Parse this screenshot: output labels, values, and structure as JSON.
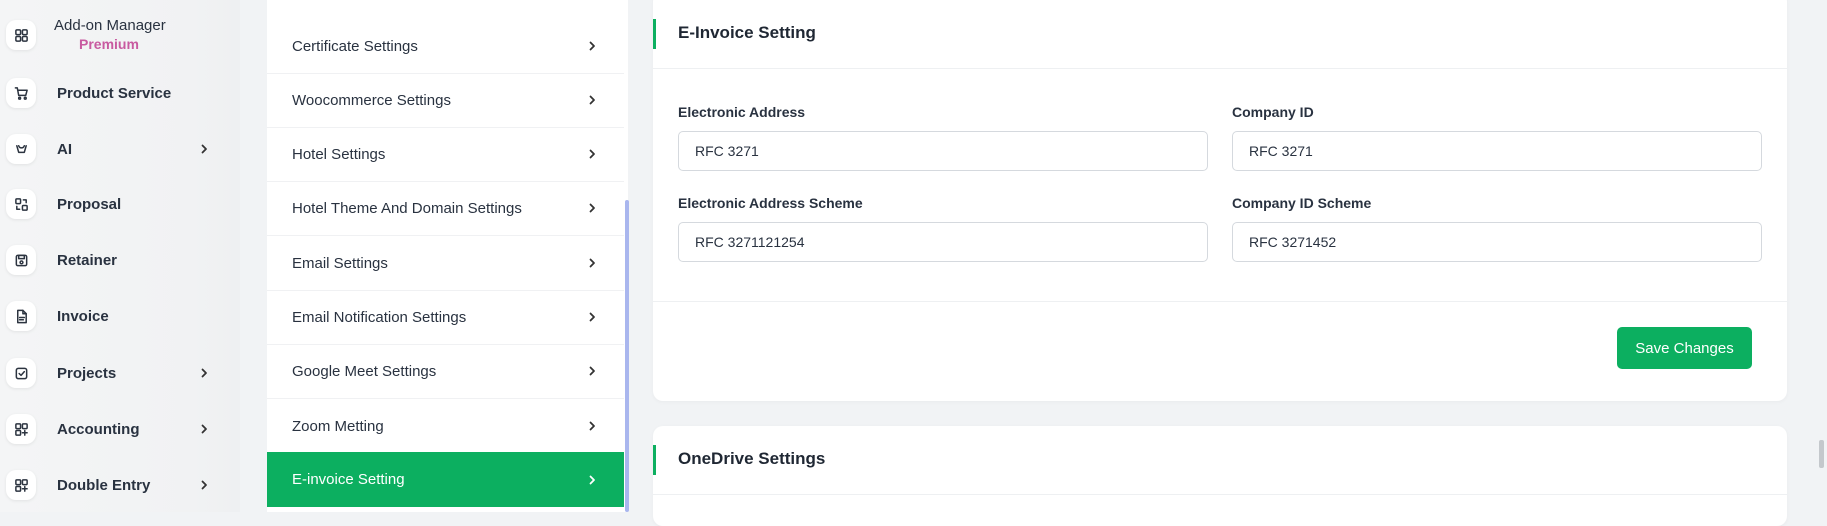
{
  "nav": {
    "items": [
      {
        "label": "Add-on Manager",
        "sub": "Premium",
        "icon": "grid-icon"
      },
      {
        "label": "Product Service",
        "icon": "cart-icon"
      },
      {
        "label": "AI",
        "icon": "ai-icon",
        "chevron": true
      },
      {
        "label": "Proposal",
        "icon": "proposal-icon"
      },
      {
        "label": "Retainer",
        "icon": "save-icon"
      },
      {
        "label": "Invoice",
        "icon": "file-icon"
      },
      {
        "label": "Projects",
        "icon": "checkbox-icon",
        "chevron": true
      },
      {
        "label": "Accounting",
        "icon": "apps-icon",
        "chevron": true
      },
      {
        "label": "Double Entry",
        "icon": "apps-icon",
        "chevron": true
      }
    ]
  },
  "settings": {
    "items": [
      {
        "label": "Certificate Settings"
      },
      {
        "label": "Woocommerce Settings"
      },
      {
        "label": "Hotel Settings"
      },
      {
        "label": "Hotel Theme And Domain Settings"
      },
      {
        "label": "Email Settings"
      },
      {
        "label": "Email Notification Settings"
      },
      {
        "label": "Google Meet Settings"
      },
      {
        "label": "Zoom Metting"
      },
      {
        "label": "E-invoice Setting",
        "active": true
      }
    ]
  },
  "einvoice": {
    "title": "E-Invoice Setting",
    "electronic_address_label": "Electronic Address",
    "electronic_address_value": "RFC 3271",
    "company_id_label": "Company ID",
    "company_id_value": "RFC 3271",
    "electronic_address_scheme_label": "Electronic Address Scheme",
    "electronic_address_scheme_value": "RFC 3271121254",
    "company_id_scheme_label": "Company ID Scheme",
    "company_id_scheme_value": "RFC 3271452",
    "save_label": "Save Changes"
  },
  "onedrive": {
    "title": "OneDrive Settings"
  },
  "colors": {
    "accent": "#0caf60",
    "premium": "#c85aa0",
    "scrollbar": "#a9b6ee"
  }
}
